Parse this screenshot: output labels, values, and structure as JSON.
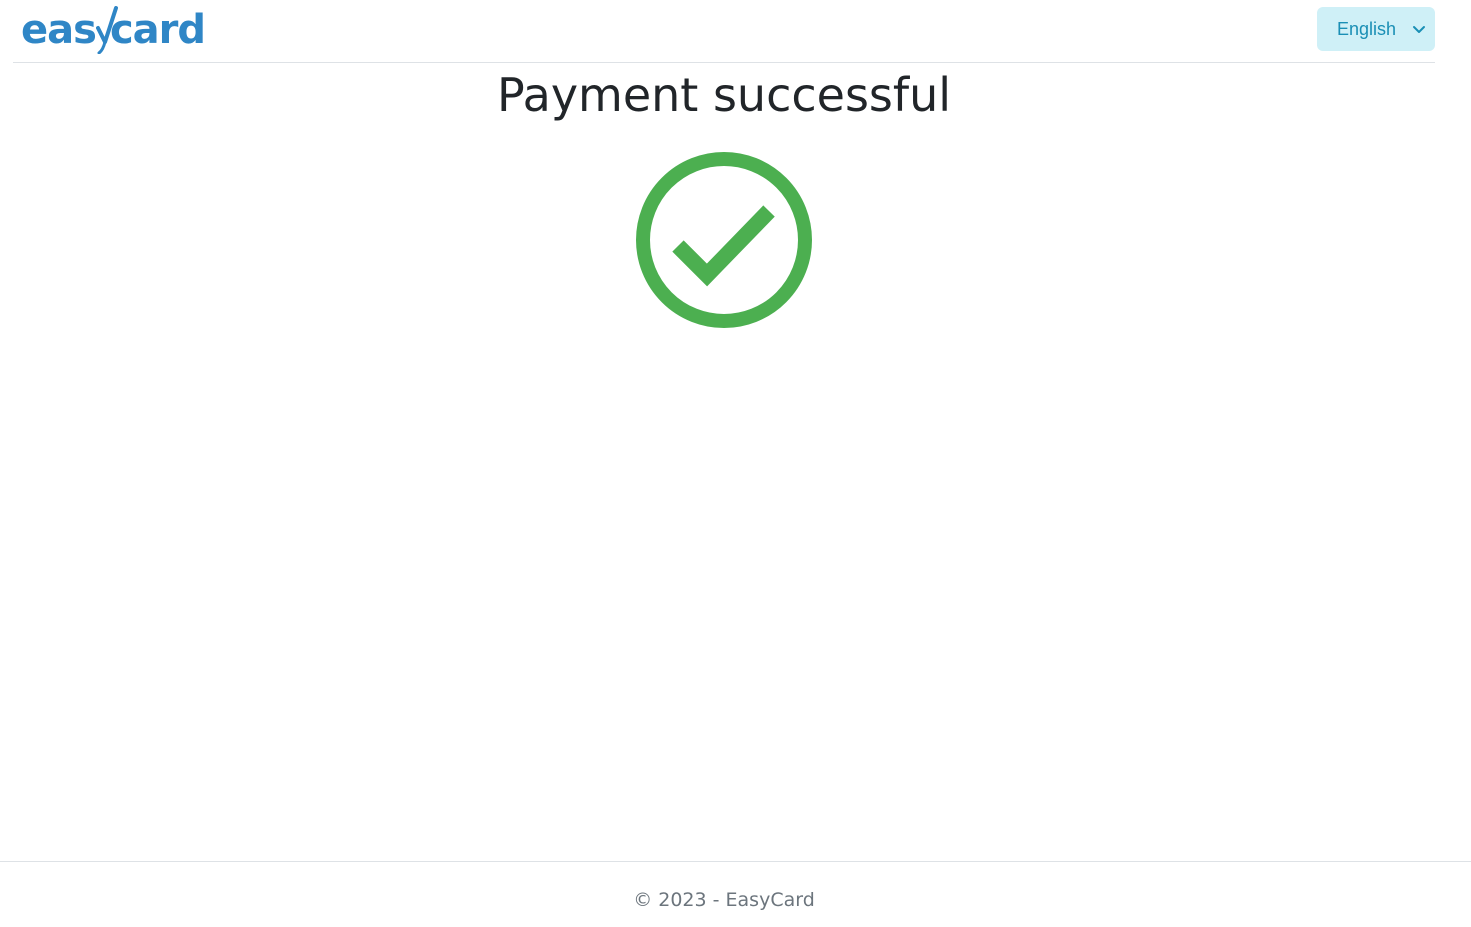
{
  "header": {
    "logo": {
      "left_text": "eas",
      "right_text": "card",
      "color": "#2f86c6"
    },
    "language_select": {
      "selected": "English",
      "background": "#cff0f7",
      "text_color": "#1a8fb5"
    }
  },
  "main": {
    "title": "Payment successful",
    "success_icon": "check-circle-icon",
    "success_color": "#4caf50"
  },
  "footer": {
    "text": "© 2023 - EasyCard"
  }
}
